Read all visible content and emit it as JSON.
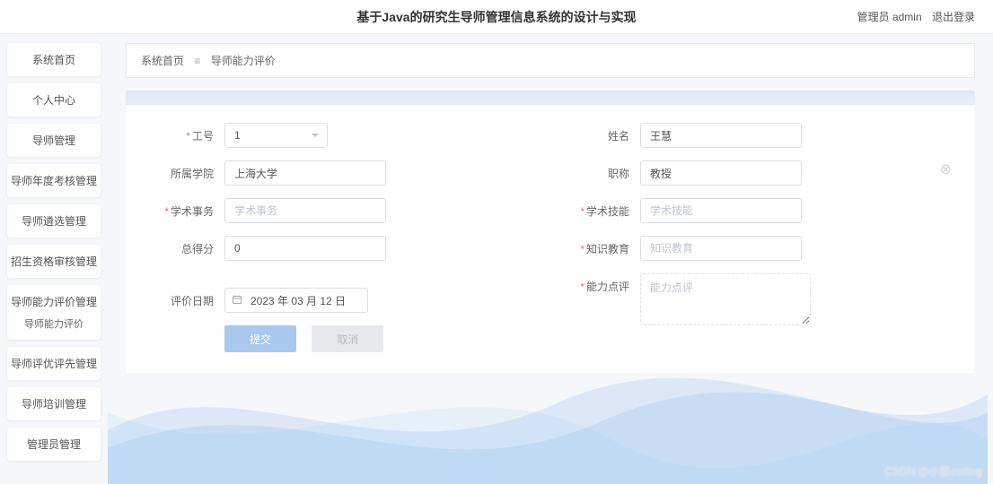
{
  "header": {
    "title": "基于Java的研究生导师管理信息系统的设计与实现",
    "role": "管理员 admin",
    "logout": "退出登录"
  },
  "sidebar": {
    "items": [
      {
        "label": "系统首页"
      },
      {
        "label": "个人中心"
      },
      {
        "label": "导师管理"
      },
      {
        "label": "导师年度考核管理"
      },
      {
        "label": "导师遴选管理"
      },
      {
        "label": "招生资格审核管理"
      },
      {
        "label": "导师能力评价管理",
        "sub": "导师能力评价"
      },
      {
        "label": "导师评优评先管理"
      },
      {
        "label": "导师培训管理"
      },
      {
        "label": "管理员管理"
      }
    ]
  },
  "breadcrumb": {
    "root": "系统首页",
    "current": "导师能力评价"
  },
  "form": {
    "left": {
      "gonghao": {
        "label": "工号",
        "value": "1"
      },
      "xueyuan": {
        "label": "所属学院",
        "value": "上海大学"
      },
      "xueshu": {
        "label": "学术事务",
        "placeholder": "学术事务"
      },
      "zongfen": {
        "label": "总得分",
        "value": "0"
      },
      "riqi": {
        "label": "评价日期",
        "value": "2023 年 03 月 12 日"
      }
    },
    "right": {
      "xingming": {
        "label": "姓名",
        "value": "王慧"
      },
      "zhicheng": {
        "label": "职称",
        "value": "教授"
      },
      "jineng": {
        "label": "学术技能",
        "placeholder": "学术技能"
      },
      "jiaoyu": {
        "label": "知识教育",
        "placeholder": "知识教育"
      },
      "dianping": {
        "label": "能力点评",
        "placeholder": "能力点评"
      }
    },
    "buttons": {
      "submit": "提交",
      "cancel": "取消"
    }
  },
  "watermark": "CSDN @小蔡coding"
}
